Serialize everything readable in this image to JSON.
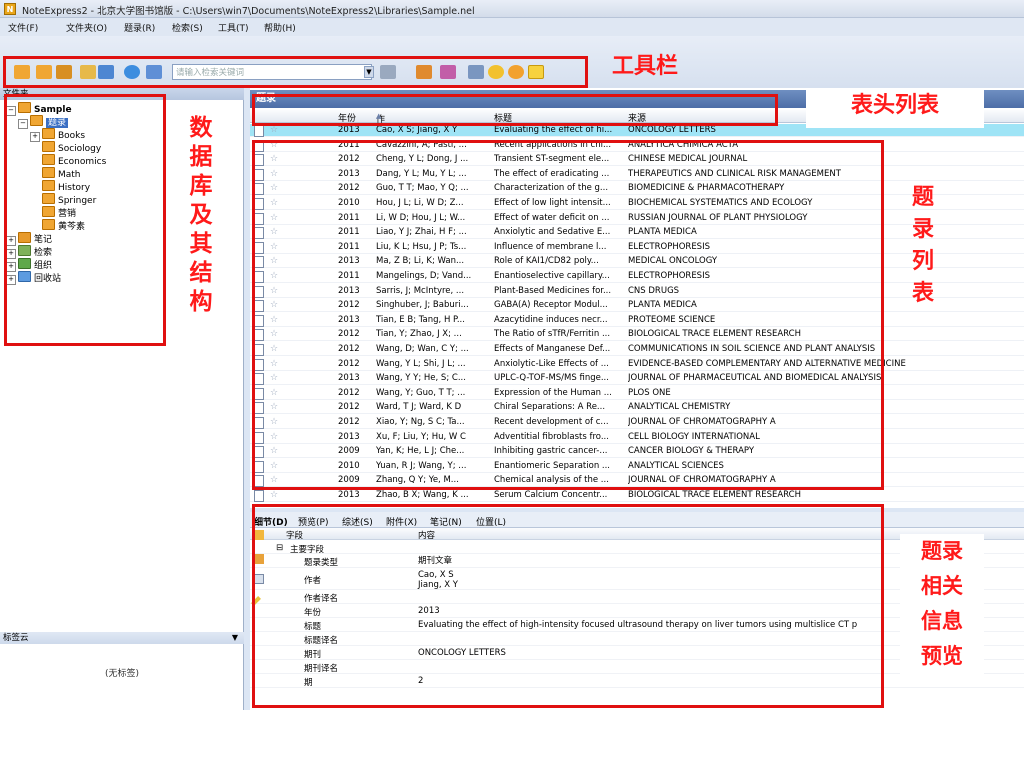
{
  "window": {
    "title": "NoteExpress2 - 北京大学图书馆版 - C:\\Users\\win7\\Documents\\NoteExpress2\\Libraries\\Sample.nel",
    "app_icon": "N"
  },
  "menu": [
    "文件(F)",
    "文件夹(O)",
    "题录(R)",
    "检索(S)",
    "工具(T)",
    "帮助(H)"
  ],
  "toolbar": {
    "search_placeholder": "请输入检索关键词"
  },
  "folders": {
    "header": "文件夹",
    "root": "Sample",
    "selected": "题录",
    "children": [
      "Books",
      "Sociology",
      "Economics",
      "Math",
      "History",
      "Springer",
      "营销",
      "黄芩素"
    ],
    "others": [
      "笔记",
      "检索",
      "组织",
      "回收站"
    ]
  },
  "tagcloud": {
    "header": "标签云",
    "empty": "(无标签)"
  },
  "list": {
    "title": "题录",
    "columns": {
      "year": "年份",
      "author": "作者",
      "title": "标题",
      "source": "来源"
    },
    "rows": [
      {
        "year": "2013",
        "author": "Cao, X S; Jiang, X Y",
        "title": "Evaluating the effect of hi...",
        "source": "ONCOLOGY LETTERS"
      },
      {
        "year": "2011",
        "author": "Cavazzini, A; Pasti, ...",
        "title": "Recent applications in chi...",
        "source": "ANALYTICA CHIMICA ACTA"
      },
      {
        "year": "2012",
        "author": "Cheng, Y L; Dong, J ...",
        "title": "Transient ST-segment ele...",
        "source": "CHINESE MEDICAL JOURNAL"
      },
      {
        "year": "2013",
        "author": "Dang, Y L; Mu, Y L; ...",
        "title": "The effect of eradicating ...",
        "source": "THERAPEUTICS AND CLINICAL RISK MANAGEMENT"
      },
      {
        "year": "2012",
        "author": "Guo, T T; Mao, Y Q; ...",
        "title": "Characterization of the g...",
        "source": "BIOMEDICINE & PHARMACOTHERAPY"
      },
      {
        "year": "2010",
        "author": "Hou, J L; Li, W D; Z...",
        "title": "Effect of low light intensit...",
        "source": "BIOCHEMICAL SYSTEMATICS AND ECOLOGY"
      },
      {
        "year": "2011",
        "author": "Li, W D; Hou, J L; W...",
        "title": "Effect of water deficit on ...",
        "source": "RUSSIAN JOURNAL OF PLANT PHYSIOLOGY"
      },
      {
        "year": "2011",
        "author": "Liao, Y J; Zhai, H F; ...",
        "title": "Anxiolytic and Sedative E...",
        "source": "PLANTA MEDICA"
      },
      {
        "year": "2011",
        "author": "Liu, K L; Hsu, J P; Ts...",
        "title": "Influence of membrane l...",
        "source": "ELECTROPHORESIS"
      },
      {
        "year": "2013",
        "author": "Ma, Z B; Li, K; Wan...",
        "title": "Role of KAI1/CD82 poly...",
        "source": "MEDICAL ONCOLOGY"
      },
      {
        "year": "2011",
        "author": "Mangelings, D; Vand...",
        "title": "Enantioselective capillary...",
        "source": "ELECTROPHORESIS"
      },
      {
        "year": "2013",
        "author": "Sarris, J; McIntyre, ...",
        "title": "Plant-Based Medicines for...",
        "source": "CNS DRUGS"
      },
      {
        "year": "2012",
        "author": "Singhuber, J; Baburi...",
        "title": "GABA(A) Receptor Modul...",
        "source": "PLANTA MEDICA"
      },
      {
        "year": "2013",
        "author": "Tian, E B; Tang, H P...",
        "title": "Azacytidine induces necr...",
        "source": "PROTEOME SCIENCE"
      },
      {
        "year": "2012",
        "author": "Tian, Y; Zhao, J X; ...",
        "title": "The Ratio of sTfR/Ferritin ...",
        "source": "BIOLOGICAL TRACE ELEMENT RESEARCH"
      },
      {
        "year": "2012",
        "author": "Wang, D; Wan, C Y; ...",
        "title": "Effects of Manganese Def...",
        "source": "COMMUNICATIONS IN SOIL SCIENCE AND PLANT ANALYSIS"
      },
      {
        "year": "2012",
        "author": "Wang, Y L; Shi, J L; ...",
        "title": "Anxiolytic-Like Effects of ...",
        "source": "EVIDENCE-BASED COMPLEMENTARY AND ALTERNATIVE MEDICINE"
      },
      {
        "year": "2013",
        "author": "Wang, Y Y; He, S; C...",
        "title": "UPLC-Q-TOF-MS/MS finge...",
        "source": "JOURNAL OF PHARMACEUTICAL AND BIOMEDICAL ANALYSIS"
      },
      {
        "year": "2012",
        "author": "Wang, Y; Guo, T T; ...",
        "title": "Expression of the Human ...",
        "source": "PLOS ONE"
      },
      {
        "year": "2012",
        "author": "Ward, T J; Ward, K D",
        "title": "Chiral Separations: A Re...",
        "source": "ANALYTICAL CHEMISTRY"
      },
      {
        "year": "2012",
        "author": "Xiao, Y; Ng, S C; Ta...",
        "title": "Recent development of c...",
        "source": "JOURNAL OF CHROMATOGRAPHY A"
      },
      {
        "year": "2013",
        "author": "Xu, F; Liu, Y; Hu, W C",
        "title": "Adventitial fibroblasts fro...",
        "source": "CELL BIOLOGY INTERNATIONAL"
      },
      {
        "year": "2009",
        "author": "Yan, K; He, L J; Che...",
        "title": "Inhibiting gastric cancer-...",
        "source": "CANCER BIOLOGY & THERAPY"
      },
      {
        "year": "2010",
        "author": "Yuan, R J; Wang, Y; ...",
        "title": "Enantiomeric Separation ...",
        "source": "ANALYTICAL SCIENCES"
      },
      {
        "year": "2009",
        "author": "Zhang, Q Y; Ye, M...",
        "title": "Chemical analysis of the ...",
        "source": "JOURNAL OF CHROMATOGRAPHY A"
      },
      {
        "year": "2013",
        "author": "Zhao, B X; Wang, K ...",
        "title": "Serum Calcium Concentr...",
        "source": "BIOLOGICAL TRACE ELEMENT RESEARCH"
      }
    ]
  },
  "detail_tabs": [
    "细节(D)",
    "预览(P)",
    "综述(S)",
    "附件(X)",
    "笔记(N)",
    "位置(L)"
  ],
  "detail": {
    "col_field": "字段",
    "col_content": "内容",
    "group": "主要字段",
    "rows": [
      {
        "field": "题录类型",
        "value": "期刊文章"
      },
      {
        "field": "作者",
        "value": "Cao, X S\nJiang, X Y"
      },
      {
        "field": "作者译名",
        "value": ""
      },
      {
        "field": "年份",
        "value": "2013"
      },
      {
        "field": "标题",
        "value": "Evaluating the effect of high-intensity focused ultrasound therapy on liver tumors using multislice CT p"
      },
      {
        "field": "标题译名",
        "value": ""
      },
      {
        "field": "期刊",
        "value": "ONCOLOGY LETTERS"
      },
      {
        "field": "期刊译名",
        "value": ""
      },
      {
        "field": "期",
        "value": "2"
      }
    ]
  },
  "annotations": {
    "toolbar": "工具栏",
    "header_list": "表头列表",
    "database": [
      "数",
      "据",
      "库",
      "及",
      "其",
      "结",
      "构"
    ],
    "records": [
      "题",
      "录",
      "列",
      "表"
    ],
    "preview": [
      "题录",
      "相关",
      "信息",
      "预览"
    ],
    "color": "#e01010"
  }
}
